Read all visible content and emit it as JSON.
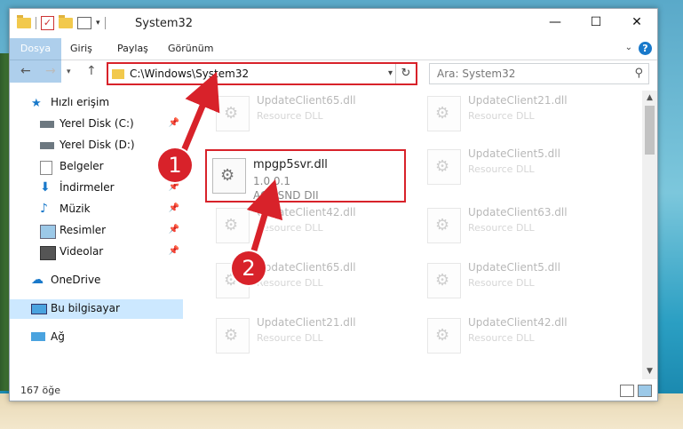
{
  "window": {
    "title": "System32"
  },
  "ribbon": {
    "tabs": [
      "Dosya",
      "Giriş",
      "Paylaş",
      "Görünüm"
    ]
  },
  "nav": {
    "address": "C:\\Windows\\System32",
    "search_placeholder": "Ara: System32"
  },
  "sidebar": {
    "items": [
      {
        "label": "Hızlı erişim",
        "icon": "star-icon"
      },
      {
        "label": "Yerel Disk (C:)",
        "icon": "drive-icon"
      },
      {
        "label": "Yerel Disk (D:)",
        "icon": "drive-icon"
      },
      {
        "label": "Belgeler",
        "icon": "documents-icon"
      },
      {
        "label": "İndirmeler",
        "icon": "download-icon"
      },
      {
        "label": "Müzik",
        "icon": "music-icon"
      },
      {
        "label": "Resimler",
        "icon": "pictures-icon"
      },
      {
        "label": "Videolar",
        "icon": "video-icon"
      },
      {
        "label": "OneDrive",
        "icon": "cloud-icon"
      },
      {
        "label": "Bu bilgisayar",
        "icon": "computer-icon"
      },
      {
        "label": "Ağ",
        "icon": "network-icon"
      }
    ]
  },
  "files": {
    "highlighted": {
      "name": "mpgp5svr.dll",
      "version": "1.0.0.1",
      "description": "ACP-SND DII"
    },
    "items": [
      {
        "name": "UpdateClient65.dll",
        "description": "Resource DLL"
      },
      {
        "name": "UpdateClient21.dll",
        "description": "Resource DLL"
      },
      {
        "name": "UpdateClient5.dll",
        "description": "Resource DLL"
      },
      {
        "name": "UpdateClient42.dll",
        "description": "Resource DLL"
      },
      {
        "name": "UpdateClient63.dll",
        "description": "Resource DLL"
      },
      {
        "name": "UpdateClient65.dll",
        "description": "Resource DLL"
      },
      {
        "name": "UpdateClient5.dll",
        "description": "Resource DLL"
      },
      {
        "name": "UpdateClient21.dll",
        "description": "Resource DLL"
      },
      {
        "name": "UpdateClient42.dll",
        "description": "Resource DLL"
      }
    ]
  },
  "status": {
    "count": "167 öğe"
  },
  "markers": [
    "1",
    "2"
  ],
  "colors": {
    "accent": "#1979ca",
    "highlight": "#d8222a"
  }
}
